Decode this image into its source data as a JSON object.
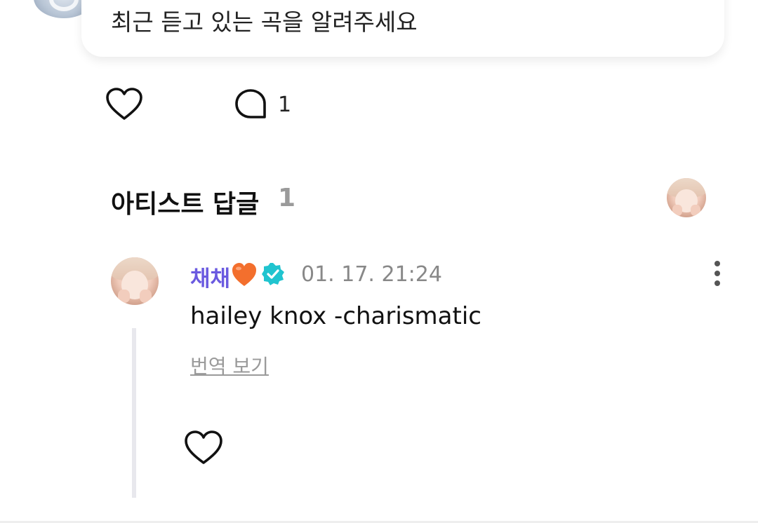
{
  "post": {
    "question": "최근 듣고 있는 곡을 알려주세요",
    "comment_count": "1"
  },
  "artist_replies": {
    "title": "아티스트 답글",
    "count": "1"
  },
  "reply": {
    "author": "채채",
    "timestamp": "01. 17. 21:24",
    "text": "hailey knox -charismatic",
    "translate_label": "번역 보기"
  },
  "colors": {
    "author_name": "#6a5ae0",
    "verified_badge": "#20c4cf",
    "heart_emoji": "#f36f2d",
    "muted_text": "#9a9a9a"
  },
  "icons": {
    "like": "heart-outline-icon",
    "comment": "speech-bubble-icon",
    "verified": "verified-badge-icon",
    "more": "kebab-menu-icon",
    "emoji": "orange-heart-emoji"
  }
}
